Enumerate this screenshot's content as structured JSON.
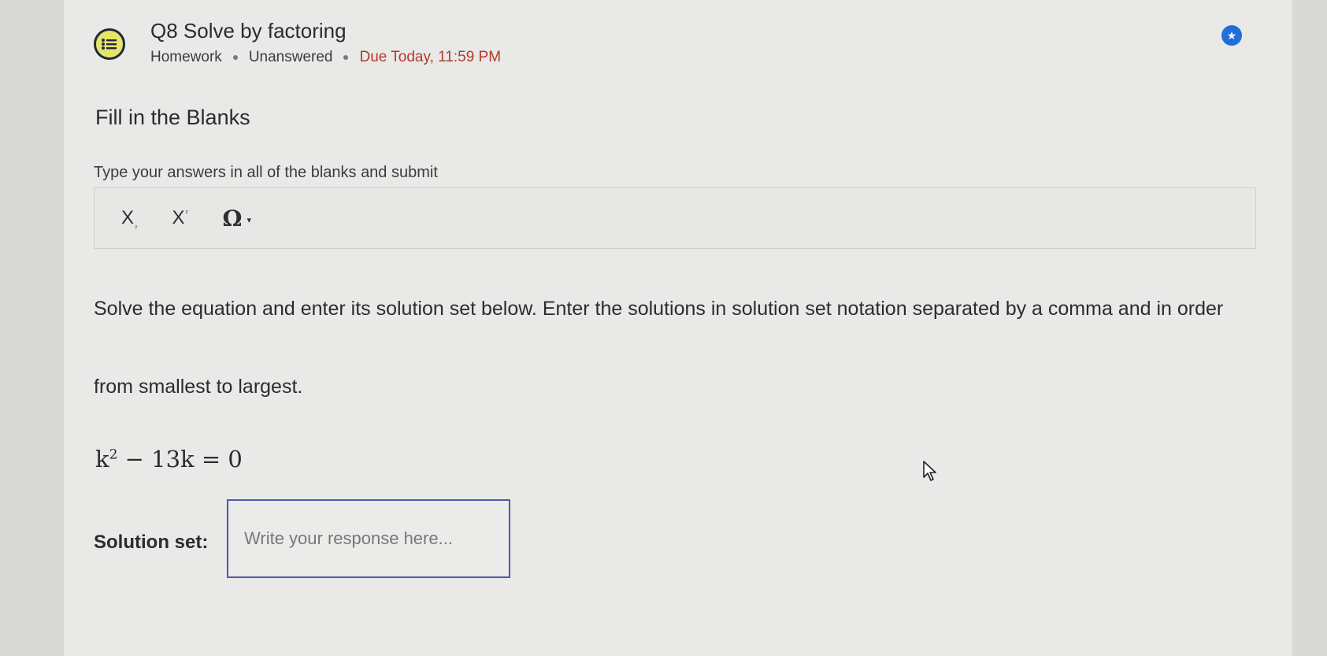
{
  "question": {
    "title": "Q8 Solve by factoring",
    "category": "Homework",
    "status": "Unanswered",
    "due": "Due Today, 11:59 PM",
    "type": "Fill in the Blanks",
    "instructions": "Type your answers in all of the blanks and submit"
  },
  "toolbar": {
    "subscript_label": "X",
    "subscript_mark": "₂",
    "superscript_label": "X",
    "superscript_mark": "²",
    "special_chars_label": "Ω",
    "caret": "▾"
  },
  "prompt": {
    "line1": "Solve the equation and enter its solution set below. Enter the solutions in solution set notation separated by a comma and in order",
    "line2": "from smallest to largest.",
    "equation_base": "k",
    "equation_exp": "2",
    "equation_rest": " − 13k = 0"
  },
  "answer": {
    "label": "Solution set:",
    "placeholder": "Write your response here...",
    "value": ""
  },
  "icons": {
    "question_icon": "list-chat-icon",
    "flag_icon": "star-badge-icon",
    "cursor": "mouse-pointer-icon"
  },
  "colors": {
    "due": "#b33a2a",
    "flag": "#1f6fd6",
    "input_border": "#4a5aa8",
    "icon_fill": "#e6e56a"
  }
}
